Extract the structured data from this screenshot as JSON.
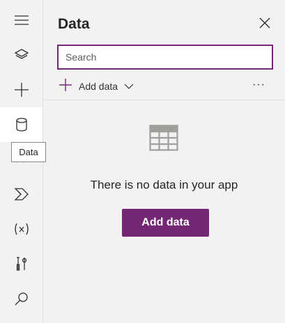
{
  "rail": {
    "items": [
      {
        "icon": "hamburger-menu-icon"
      },
      {
        "icon": "layers-icon"
      },
      {
        "icon": "plus-icon"
      },
      {
        "icon": "database-icon",
        "active": true
      },
      {
        "icon": "media-icon"
      },
      {
        "icon": "power-automate-icon"
      },
      {
        "icon": "variables-icon"
      },
      {
        "icon": "advanced-tools-icon"
      },
      {
        "icon": "search-icon"
      }
    ],
    "tooltip": "Data"
  },
  "panel": {
    "title": "Data",
    "search_placeholder": "Search",
    "add_data_label": "Add data",
    "more_label": "···",
    "empty_message": "There is no data in your app",
    "primary_button_label": "Add data"
  },
  "colors": {
    "accent": "#742774",
    "background": "#f3f2f1"
  }
}
